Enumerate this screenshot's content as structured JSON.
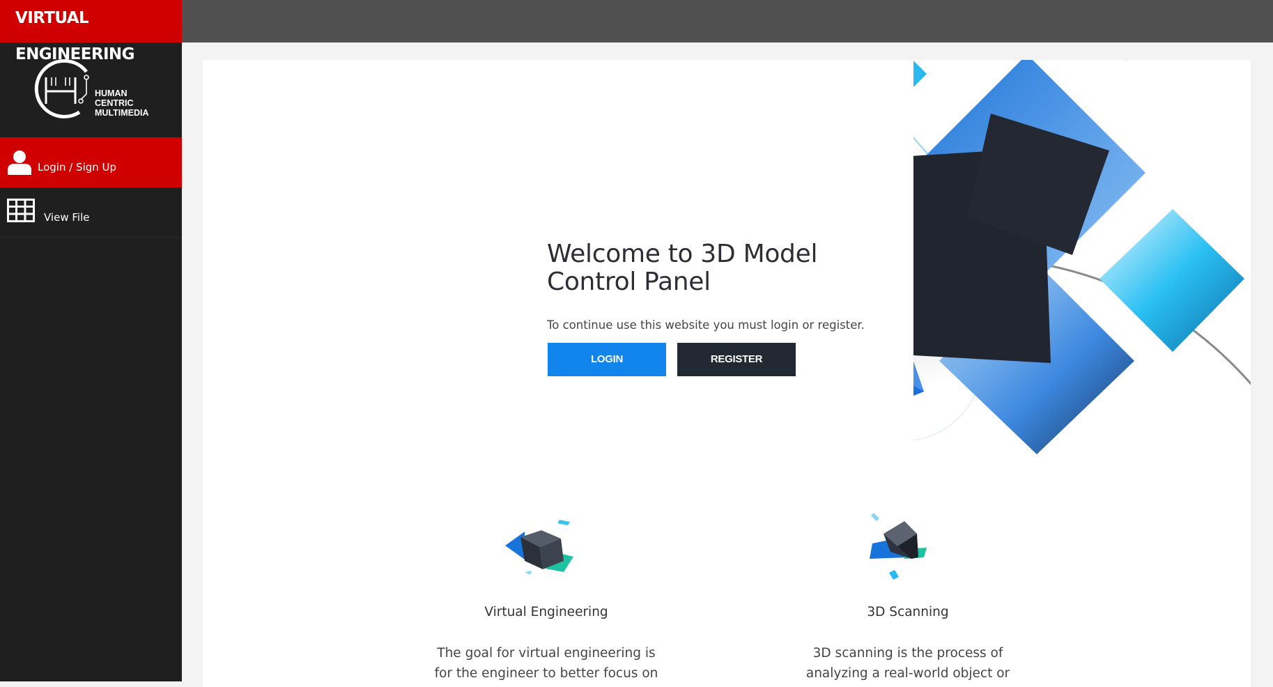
{
  "app": {
    "brand": "VIRTUAL ENGINEERING"
  },
  "logo": {
    "line1": "HUMAN",
    "line2": "CENTRIC",
    "line3": "MULTIMEDIA"
  },
  "sidebar": {
    "items": [
      {
        "label": "Login / Sign Up",
        "icon": "user-icon",
        "active": true
      },
      {
        "label": "View File",
        "icon": "grid-table-icon",
        "active": false
      }
    ]
  },
  "main": {
    "welcome_title": "Welcome to 3D Model Control Panel",
    "subtitle": "To continue use this website you must login or register.",
    "login_label": "LOGIN",
    "register_label": "REGISTER"
  },
  "features": [
    {
      "title": "Virtual Engineering",
      "desc": "The goal for virtual engineering is for the engineer to better focus on"
    },
    {
      "title": "3D Scanning",
      "desc": "3D scanning is the process of analyzing a real-world object or"
    }
  ],
  "colors": {
    "brand_red": "#d10000",
    "sidebar_bg": "#1f1f1f",
    "topbar_bg": "#505050",
    "login_blue": "#1185ec",
    "register_dark": "#222933"
  }
}
